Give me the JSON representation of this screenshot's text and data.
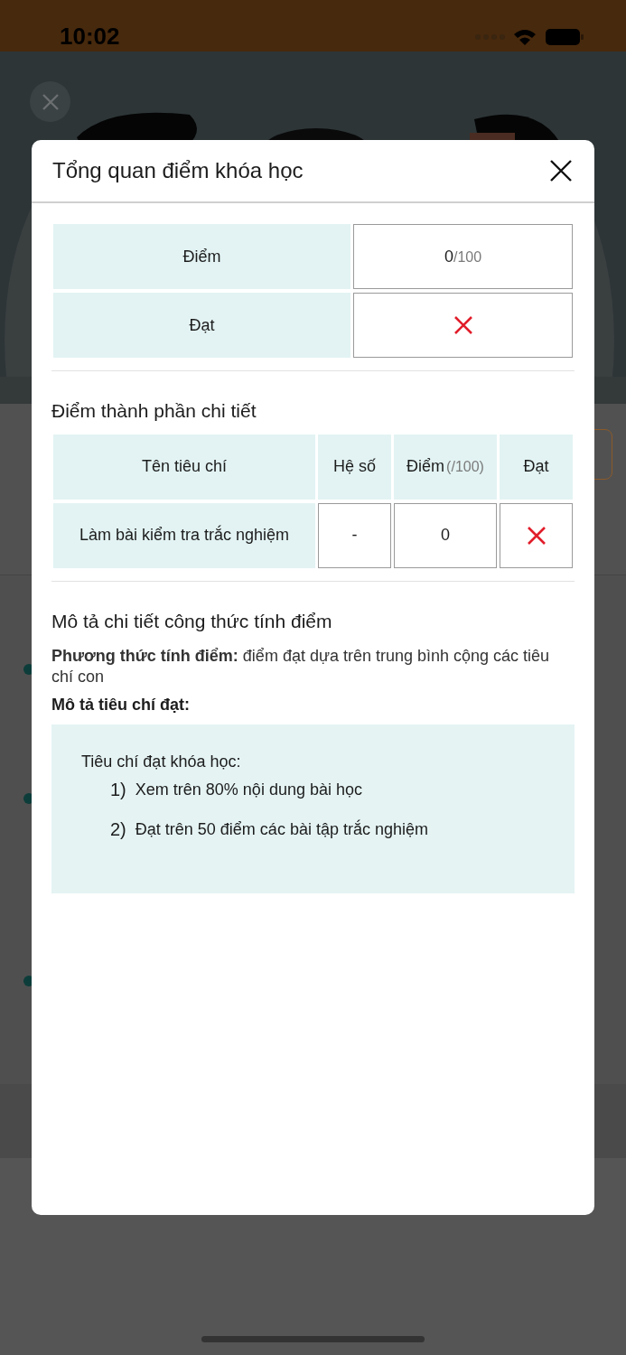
{
  "status_bar": {
    "time": "10:02"
  },
  "dialog": {
    "title": "Tổng quan điểm khóa học",
    "summary": [
      {
        "label": "Điểm",
        "kind": "score",
        "value": "0",
        "max": "/100"
      },
      {
        "label": "Đạt",
        "kind": "pass",
        "passed": false
      }
    ],
    "detail_section": {
      "title": "Điểm thành phần chi tiết",
      "columns": [
        {
          "label": "Tên tiêu chí"
        },
        {
          "label": "Hệ số"
        },
        {
          "label": "Điểm",
          "unit": "(/100)"
        },
        {
          "label": "Đạt"
        }
      ],
      "rows": [
        {
          "name": "Làm bài kiểm tra trắc nghiệm",
          "weight": "-",
          "score": "0",
          "passed": false
        }
      ]
    },
    "formula_section": {
      "title": "Mô tả chi tiết công thức tính điểm",
      "method": "**Phương thức tính điểm:** điểm đạt dựa trên trung bình cộng các tiêu chí con",
      "criteria_label": "Mô tả tiêu chí đạt:",
      "criteria": {
        "intro": "Tiêu chí đạt khóa học:",
        "items": [
          {
            "number": "1)",
            "text": "Xem trên 80% nội dung bài học"
          },
          {
            "number": "2)",
            "text": "Đạt trên 50 điểm các bài tập trắc nghiệm"
          }
        ]
      }
    }
  }
}
